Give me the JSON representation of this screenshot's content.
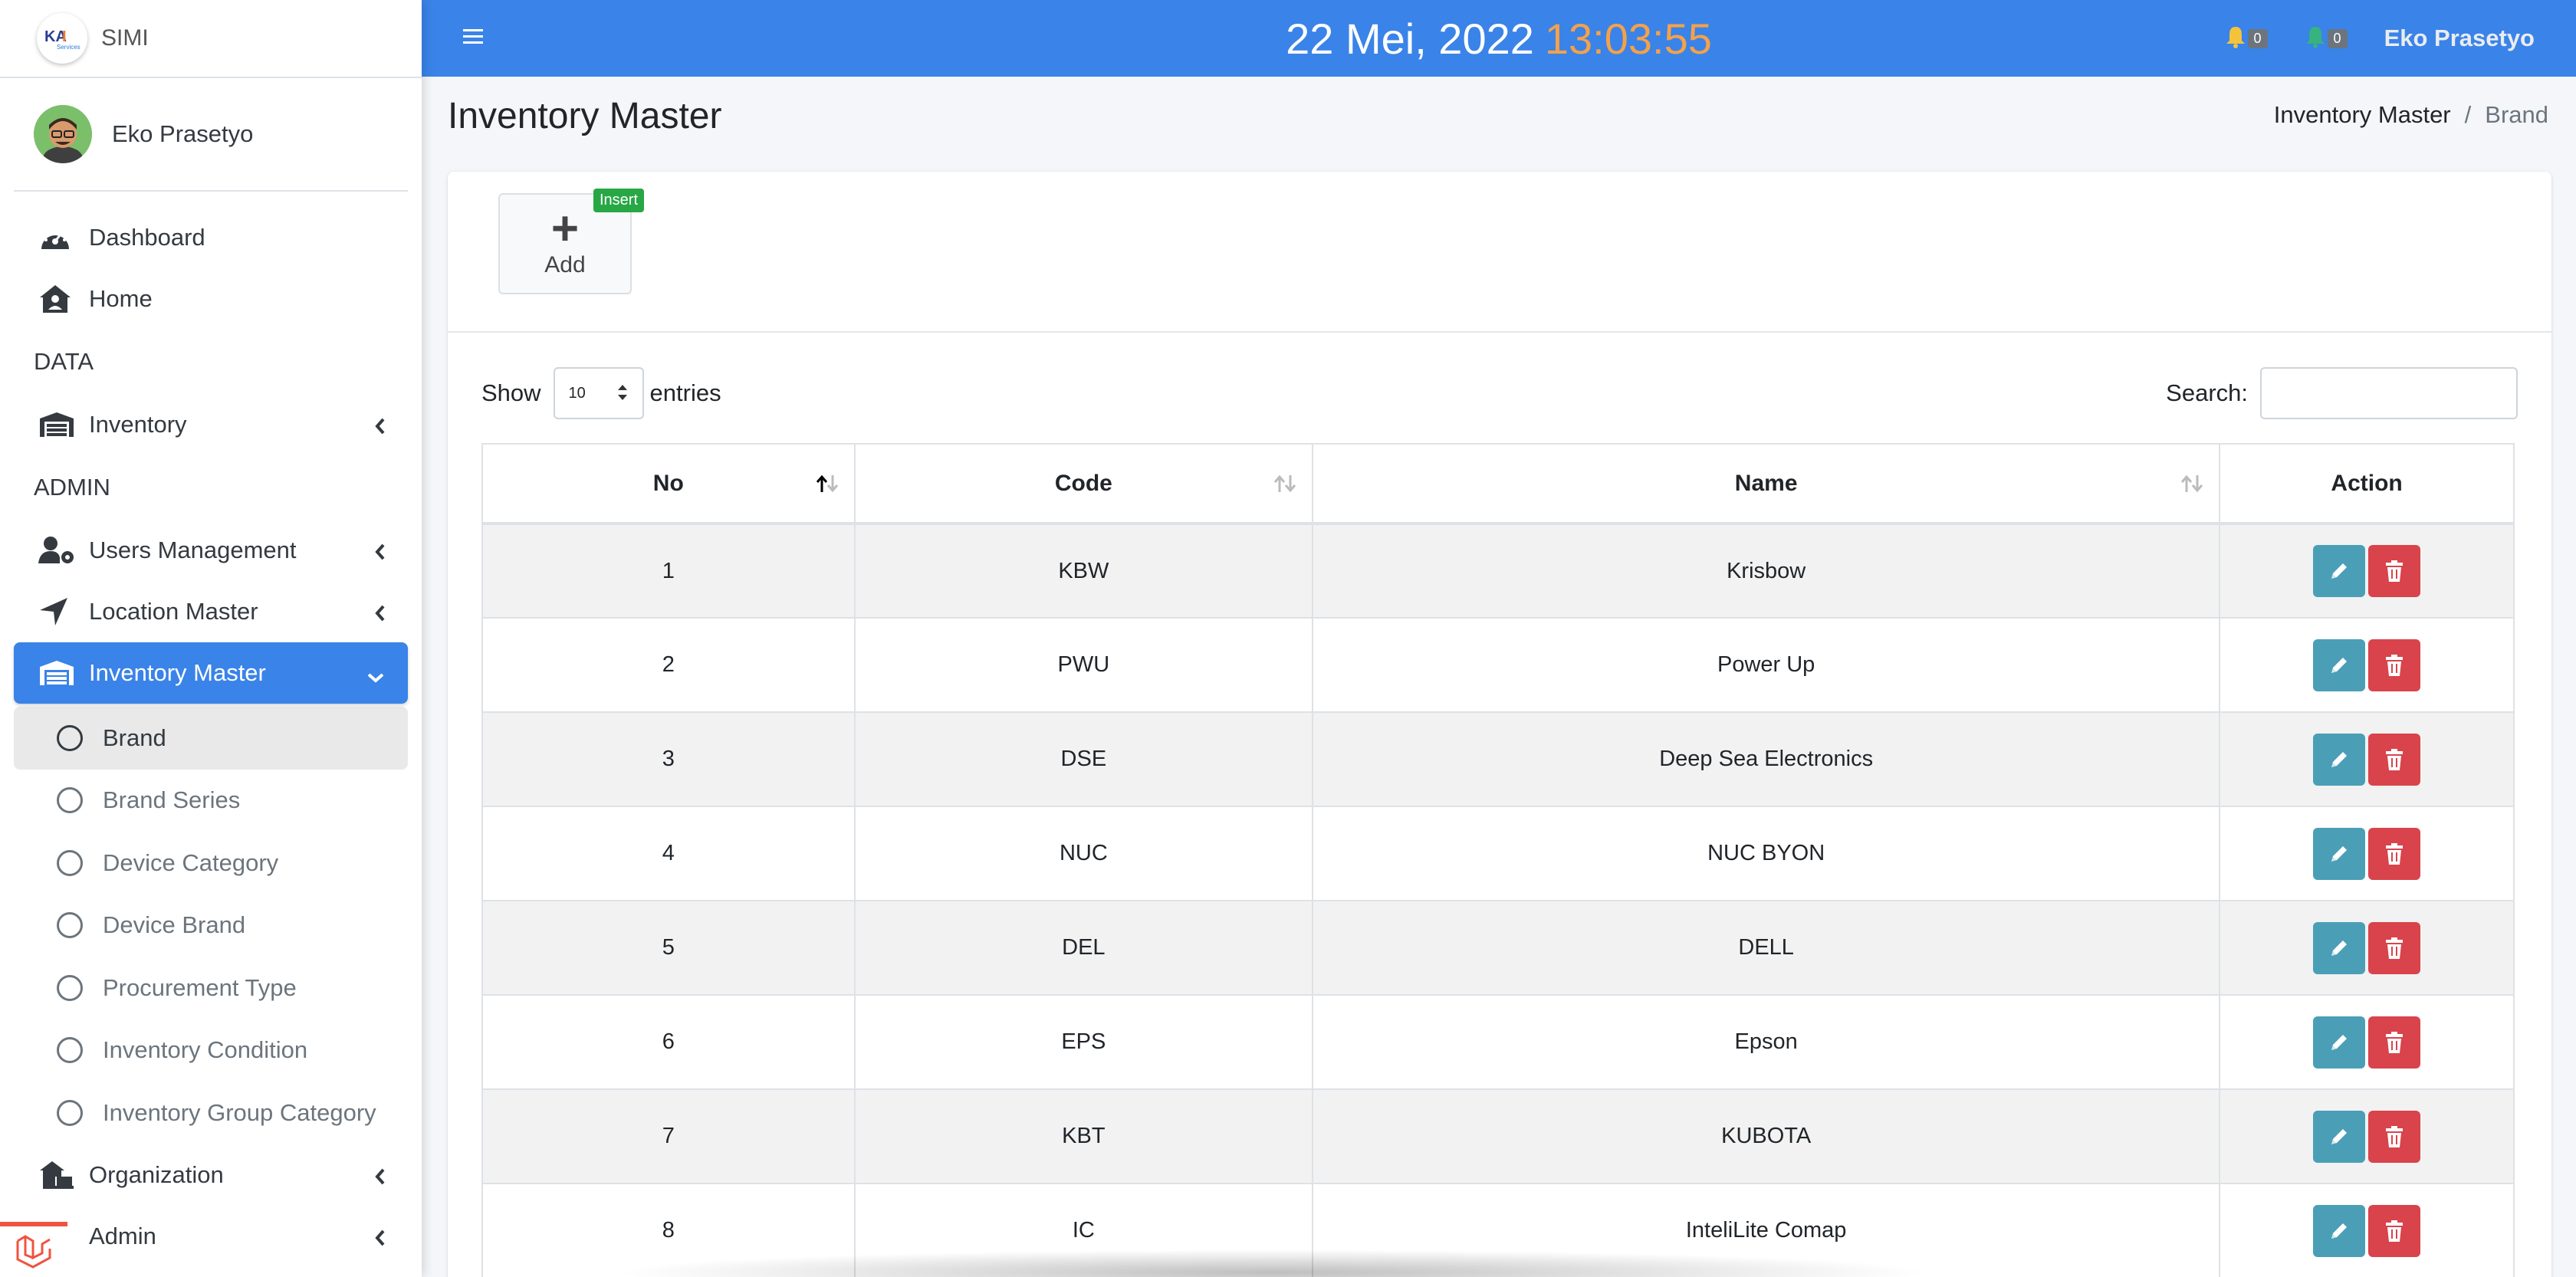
{
  "app": {
    "name": "SIMI",
    "user_name": "Eko Prasetyo"
  },
  "topbar": {
    "date": "22 Mei, 2022",
    "time": "13:03:55",
    "notif_count_1": "0",
    "notif_count_2": "0",
    "user_name": "Eko Prasetyo"
  },
  "sidebar": {
    "items": [
      {
        "label": "Dashboard",
        "icon": "gauge-icon"
      },
      {
        "label": "Home",
        "icon": "house-icon"
      }
    ],
    "header_data": "DATA",
    "inventory": "Inventory",
    "header_admin": "ADMIN",
    "users_management": "Users Management",
    "location_master": "Location Master",
    "inventory_master": "Inventory Master",
    "sub_items": [
      "Brand",
      "Brand Series",
      "Device Category",
      "Device Brand",
      "Procurement Type",
      "Inventory Condition",
      "Inventory Group Category"
    ],
    "organization": "Organization",
    "admin": "Admin"
  },
  "page": {
    "title": "Inventory Master",
    "breadcrumb": [
      "Inventory Master",
      "Brand"
    ]
  },
  "toolbar": {
    "add_label": "Add",
    "insert_badge": "Insert"
  },
  "table_controls": {
    "show_label": "Show",
    "entries_value": "10",
    "entries_label": "entries",
    "search_label": "Search:",
    "search_value": ""
  },
  "table": {
    "columns": [
      "No",
      "Code",
      "Name",
      "Action"
    ],
    "rows": [
      {
        "no": "1",
        "code": "KBW",
        "name": "Krisbow"
      },
      {
        "no": "2",
        "code": "PWU",
        "name": "Power Up"
      },
      {
        "no": "3",
        "code": "DSE",
        "name": "Deep Sea Electronics"
      },
      {
        "no": "4",
        "code": "NUC",
        "name": "NUC BYON"
      },
      {
        "no": "5",
        "code": "DEL",
        "name": "DELL"
      },
      {
        "no": "6",
        "code": "EPS",
        "name": "Epson"
      },
      {
        "no": "7",
        "code": "KBT",
        "name": "KUBOTA"
      },
      {
        "no": "8",
        "code": "IC",
        "name": "InteliLite Comap"
      }
    ]
  },
  "colors": {
    "primary": "#3a83e8",
    "time": "#f4a14a",
    "edit": "#4a9fb6",
    "delete": "#d9434b",
    "insert": "#28a745"
  }
}
